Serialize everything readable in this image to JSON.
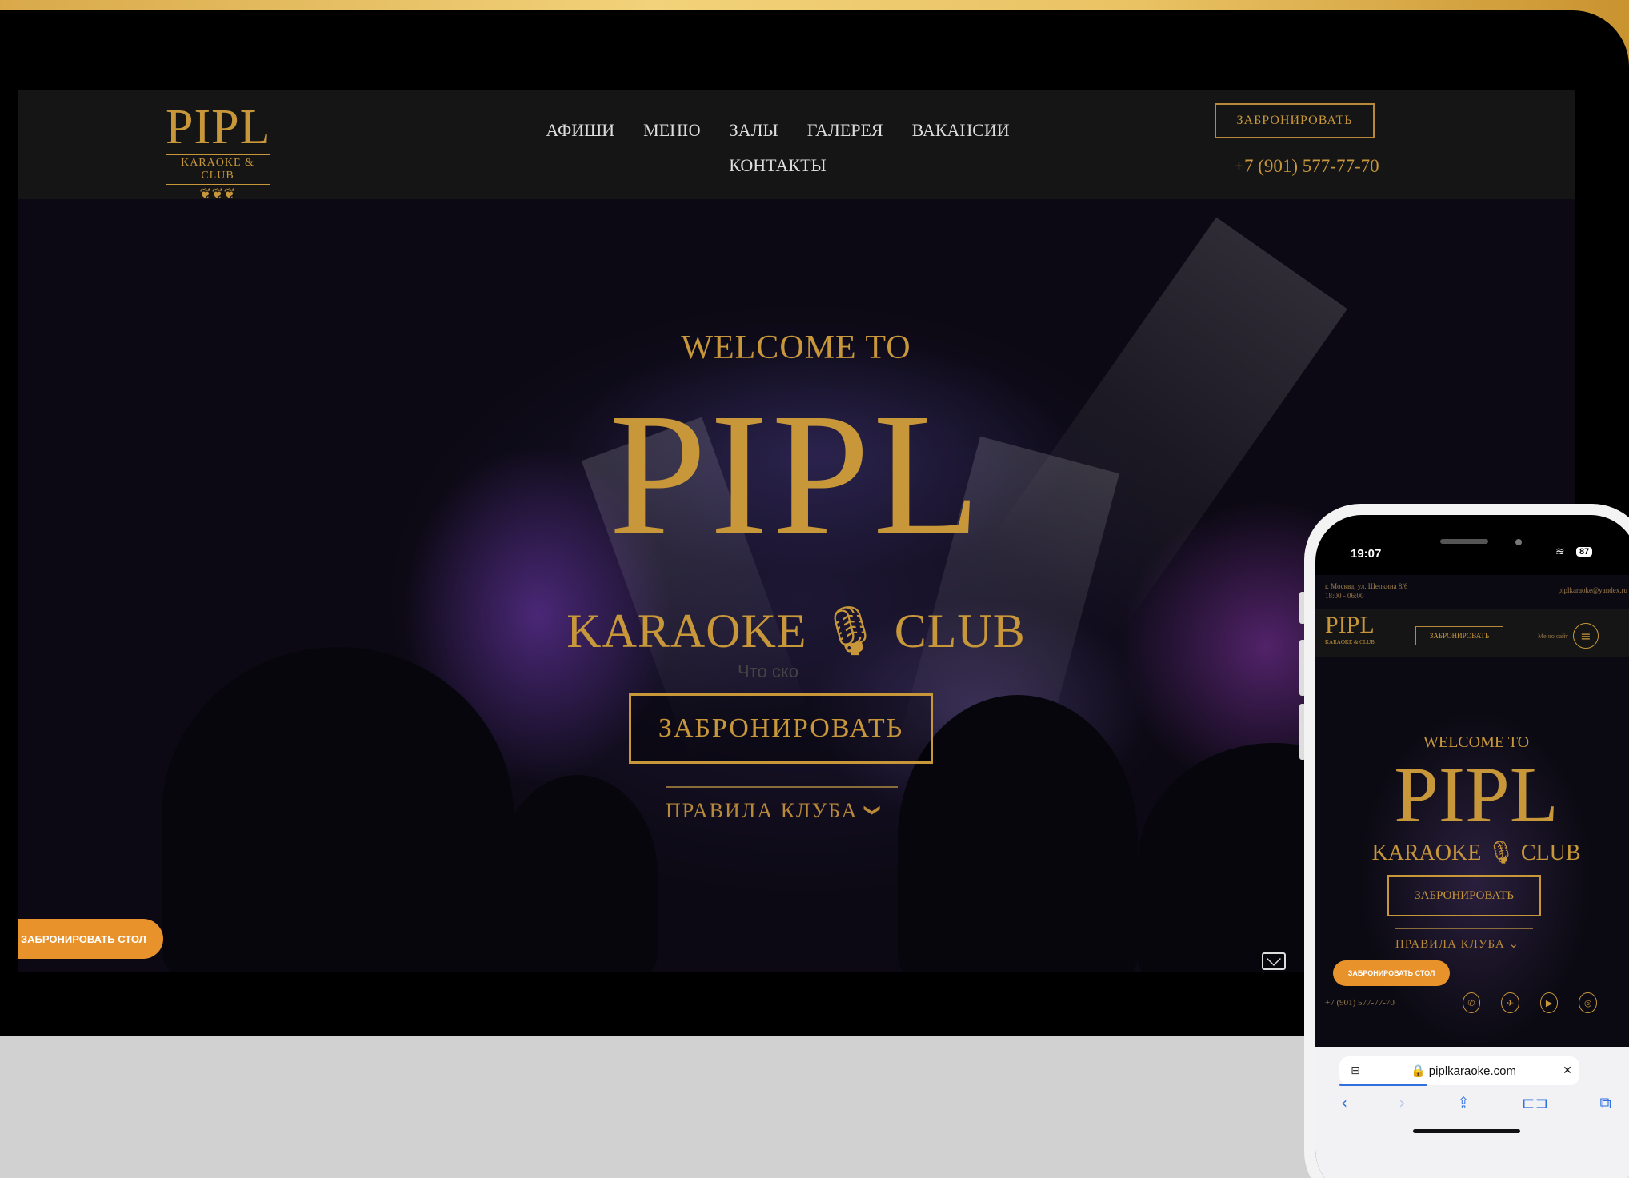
{
  "desktop": {
    "logo": {
      "main": "PIPL",
      "sub": "KARAOKE & CLUB",
      "ornament": "❦❦❦"
    },
    "nav": {
      "row1": [
        "АФИШИ",
        "МЕНЮ",
        "ЗАЛЫ",
        "ГАЛЕРЕЯ",
        "ВАКАНСИИ"
      ],
      "row2": [
        "КОНТАКТЫ"
      ]
    },
    "header_button": "ЗАБРОНИРОВАТЬ",
    "header_phone": "+7 (901) 577-77-70",
    "hero": {
      "welcome": "WELCOME TO",
      "title": "PIPL",
      "subtitle": "KARAOKE 🎙 CLUB",
      "overlay_text": "Что ско",
      "book_button": "ЗАБРОНИРОВАТЬ",
      "rules": "ПРАВИЛА КЛУБА",
      "rules_chevron": "❯"
    },
    "floating_button": "ЗАБРОНИРОВАТЬ СТОЛ",
    "mail_icon": "mail-icon"
  },
  "phone": {
    "status": {
      "time": "19:07",
      "battery": "87",
      "wifi": "≋"
    },
    "info": {
      "address": "г. Москва, ул. Щепкина 8/6",
      "hours": "18:00 - 06:00",
      "email": "piplkaraoke@yandex.ru"
    },
    "logo": {
      "main": "PIPL",
      "sub": "KARAOKE & CLUB"
    },
    "header_button": "ЗАБРОНИРОВАТЬ",
    "menu_label": "Меню сайт",
    "burger": "≡",
    "hero": {
      "welcome": "WELCOME TO",
      "title": "PIPL",
      "subtitle": "KARAOKE 🎙 CLUB",
      "book_button": "ЗАБРОНИРОВАТЬ",
      "rules": "ПРАВИЛА КЛУБА ⌄"
    },
    "floating_button": "ЗАБРОНИРОВАТЬ СТОЛ",
    "bottom_phone": "+7 (901) 577-77-70",
    "social": [
      "✆",
      "✈",
      "▶",
      "◎"
    ],
    "browser": {
      "url": "🔒 piplkaraoke.com",
      "tabs_icon": "⊟",
      "close": "✕",
      "toolbar": [
        "‹",
        "›",
        "⇪",
        "⊏⊐",
        "⧉"
      ]
    }
  },
  "colors": {
    "gold": "#c8973a",
    "orange": "#e8922c",
    "bg": "#000000"
  }
}
